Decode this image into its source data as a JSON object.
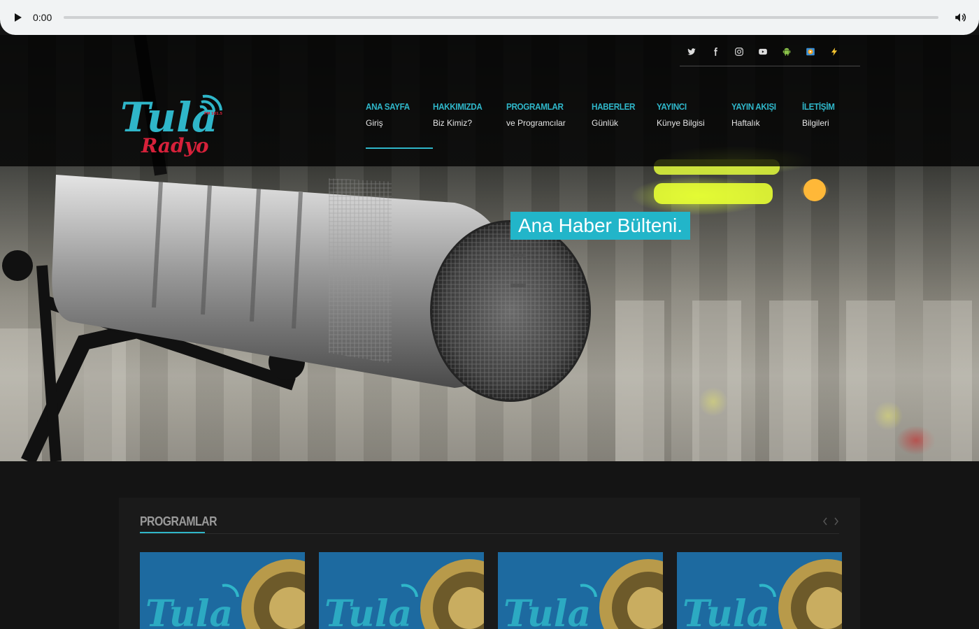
{
  "audio": {
    "time": "0:00",
    "progress": 0
  },
  "colors": {
    "accent": "#2fb6c9",
    "headline_bg": "#22b5c9",
    "logo_red": "#d6213a"
  },
  "social": [
    {
      "name": "twitter-icon"
    },
    {
      "name": "facebook-icon"
    },
    {
      "name": "instagram-icon"
    },
    {
      "name": "youtube-icon"
    },
    {
      "name": "android-icon"
    },
    {
      "name": "media-player-icon"
    },
    {
      "name": "winamp-icon"
    }
  ],
  "logo": {
    "text_main": "Tula",
    "text_sub": "Radyo",
    "text_fm": "FM 101.5"
  },
  "nav": [
    {
      "title": "ANA SAYFA",
      "sub": "Giriş"
    },
    {
      "title": "HAKKIMIZDA",
      "sub": "Biz Kimiz?"
    },
    {
      "title": "PROGRAMLAR",
      "sub": "ve Programcılar"
    },
    {
      "title": "HABERLER",
      "sub": "Günlük"
    },
    {
      "title": "YAYINCI",
      "sub": "Künye Bilgisi"
    },
    {
      "title": "YAYIN AKIŞI",
      "sub": "Haftalık"
    },
    {
      "title": "İLETİŞİM",
      "sub": "Bilgileri"
    }
  ],
  "hero": {
    "headline": "Ana Haber Bülteni."
  },
  "programs": {
    "title": "PROGRAMLAR"
  }
}
